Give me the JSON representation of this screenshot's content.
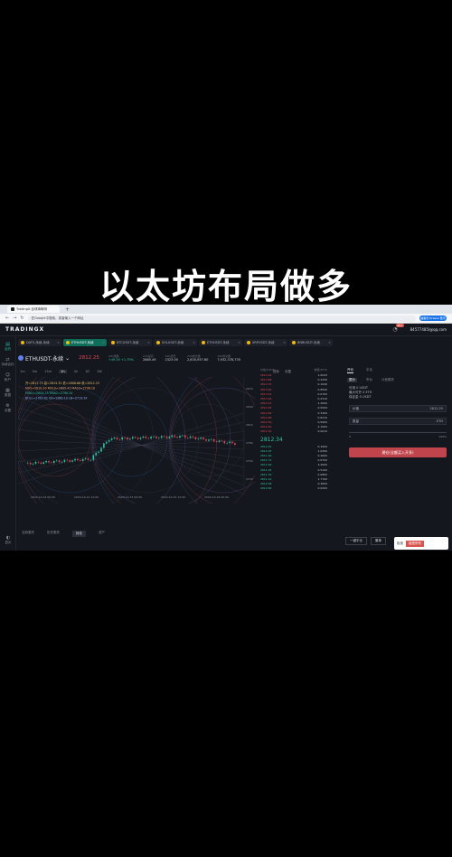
{
  "caption": "以太坊布局做多",
  "browser": {
    "tab_title": "TradingX-全球清晰明",
    "address": "在Google中搜索，或者输入一个网址",
    "extension_label": "抽屉式 Drawer 数字"
  },
  "app": {
    "logo": "TRADINGX",
    "notification_count": "99+",
    "user_email": "84577485l@qq.com"
  },
  "sidebar": {
    "items": [
      {
        "label": "合约",
        "icon": "chart-icon"
      },
      {
        "label": "永续合约",
        "icon": "swap-icon"
      },
      {
        "label": "帐户",
        "icon": "user-icon"
      },
      {
        "label": "数据",
        "icon": "data-icon"
      },
      {
        "label": "设置",
        "icon": "gear-icon"
      },
      {
        "label": "显示",
        "icon": "display-icon"
      }
    ]
  },
  "symbol_tabs": [
    {
      "label": "DATS-永续-永续",
      "active": false
    },
    {
      "label": "ETHUSDT-永续",
      "active": true
    },
    {
      "label": "BTCUSDT-永续",
      "active": false
    },
    {
      "label": "SOLUSDT-永续",
      "active": false
    },
    {
      "label": "ETHUSDT-永续",
      "active": false
    },
    {
      "label": "XRPUSDT-永续",
      "active": false
    },
    {
      "label": "BNBUSDT-永续",
      "active": false
    }
  ],
  "ticker": {
    "pair": "ETHUSDT-永续",
    "price": "2812.25",
    "stats": [
      {
        "label": "24h涨跌",
        "value": "+49.50 +1.79%",
        "green": true
      },
      {
        "label": "24h最高",
        "value": "2865.49",
        "green": false
      },
      {
        "label": "24h最低",
        "value": "2323.05",
        "green": false
      },
      {
        "label": "24h成交量",
        "value": "2,830,937.60",
        "green": false
      },
      {
        "label": "24h成交额",
        "value": "7,932,378,735",
        "green": false
      }
    ]
  },
  "timeframes": [
    "1m",
    "5m",
    "15m",
    "1h",
    "4h",
    "1D",
    "1W"
  ],
  "active_timeframe": "1h",
  "chart_tools": [
    "指标",
    "设置"
  ],
  "indicator_lines": [
    "开=2812.75 高=2815.32 低=2808.66 收=2812.25",
    "MA5=2810.20 MA10=2805.41 MA20=2796.10",
    "EMA1=2804.75 EMA2=2790.34",
    "BOLL=2789.82 UB=2860.10 LB=2719.54"
  ],
  "chart_time_labels": [
    "2024-10-14 00:00",
    "2024-10-14 12:00",
    "2024-10-15 00:00",
    "2024-10-15 12:00",
    "2024-10-16 00:00"
  ],
  "chart_price_labels": [
    "2870",
    "2840",
    "2810",
    "2780",
    "2750",
    "2720"
  ],
  "bottom_tabs": [
    "当前委托",
    "历史委托",
    "持仓",
    "资产"
  ],
  "active_bottom_tab": "持仓",
  "orderbook": {
    "headers": [
      "价格(USDT)",
      "数量(ETH)"
    ],
    "asks": [
      [
        "2814.02",
        "1.0043"
      ],
      [
        "2813.88",
        "0.4330"
      ],
      [
        "2813.75",
        "0.1040"
      ],
      [
        "2813.60",
        "0.8500"
      ],
      [
        "2813.41",
        "0.0700"
      ],
      [
        "2813.26",
        "0.2310"
      ],
      [
        "2813.10",
        "1.2000"
      ],
      [
        "2812.95",
        "0.0500"
      ],
      [
        "2812.80",
        "0.3300"
      ],
      [
        "2812.66",
        "0.6210"
      ],
      [
        "2812.50",
        "0.0900"
      ],
      [
        "2812.40",
        "2.1000"
      ],
      [
        "2812.30",
        "0.0010"
      ]
    ],
    "mid_price": "2812.34",
    "bids": [
      [
        "2812.20",
        "0.4400"
      ],
      [
        "2812.05",
        "1.0300"
      ],
      [
        "2811.90",
        "0.2600"
      ],
      [
        "2811.72",
        "0.0700"
      ],
      [
        "2811.60",
        "3.2000"
      ],
      [
        "2811.45",
        "0.5100"
      ],
      [
        "2811.30",
        "0.0800"
      ],
      [
        "2811.12",
        "1.7700"
      ],
      [
        "2810.98",
        "0.3600"
      ],
      [
        "2810.80",
        "0.0200"
      ]
    ]
  },
  "trade_panel": {
    "tabs": [
      "开仓",
      "平仓"
    ],
    "modes": [
      "限价",
      "市价",
      "计划委托"
    ],
    "info": [
      "可用 0 USDT",
      "最大可开 0 ETH",
      "保证金 0 USDT"
    ],
    "price_label": "价格",
    "price_value": "2812.25",
    "qty_label": "数量",
    "qty_unit": "ETH",
    "slider_min": "0",
    "slider_max": "100%",
    "submit": "建仓(全额买入开多)"
  },
  "footer_buttons": [
    "一键平仓",
    "撤单"
  ],
  "cookie": {
    "reject": "拒绝",
    "accept": "接受所有"
  }
}
